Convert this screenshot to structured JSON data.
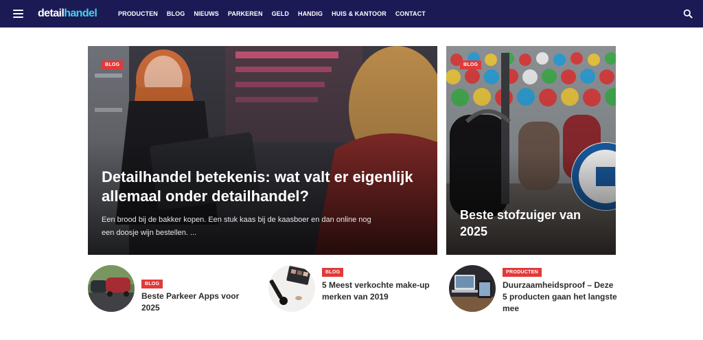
{
  "brand": {
    "logo_part1": "detail",
    "logo_part2": "handel"
  },
  "nav": {
    "items": [
      "PRODUCTEN",
      "BLOG",
      "NIEUWS",
      "PARKEREN",
      "GELD",
      "HANDIG",
      "HUIS & KANTOOR",
      "CONTACT"
    ]
  },
  "hero_main": {
    "category": "BLOG",
    "title": "Detailhandel betekenis: wat valt er eigenlijk allemaal onder detailhandel?",
    "excerpt": "Een brood bij de bakker kopen. Een stuk kaas bij de kaasboer en dan online nog een doosje wijn bestellen. ..."
  },
  "hero_side": {
    "category": "BLOG",
    "title": "Beste stofzuiger van 2025"
  },
  "posts": [
    {
      "category": "BLOG",
      "title": "Beste Parkeer Apps voor 2025"
    },
    {
      "category": "BLOG",
      "title": "5 Meest verkochte make-up merken van 2019"
    },
    {
      "category": "PRODUCTEN",
      "title": "Duurzaamheidsproof – Deze 5 producten gaan het langste mee"
    }
  ],
  "colors": {
    "navbar": "#1b1a55",
    "accent": "#e03a3a",
    "logo_accent": "#3ed3ee"
  },
  "icons": {
    "menu": "hamburger-icon",
    "search": "search-icon"
  }
}
